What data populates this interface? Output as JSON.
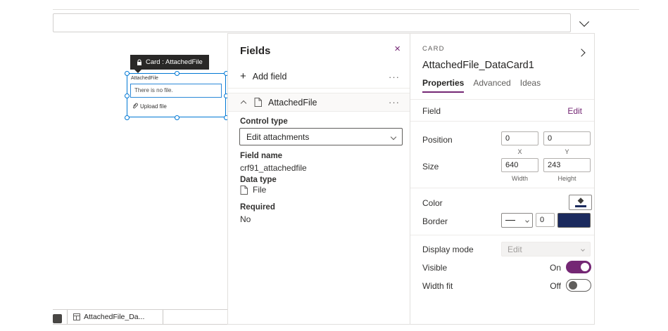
{
  "icons": {
    "ellipsis": "···",
    "close": "×",
    "plus": "+"
  },
  "canvas": {
    "tooltip_label": "Card : AttachedFile",
    "card_label": "AttachedFile",
    "no_file_text": "There is no file.",
    "upload_text": "Upload file"
  },
  "fields_panel": {
    "title": "Fields",
    "add_field_label": "Add field",
    "item_name": "AttachedFile",
    "control_type_label": "Control type",
    "control_type_value": "Edit attachments",
    "field_name_label": "Field name",
    "field_name_value": "crf91_attachedfile",
    "data_type_label": "Data type",
    "data_type_value": "File",
    "required_label": "Required",
    "required_value": "No"
  },
  "properties_panel": {
    "breadcrumb": "CARD",
    "title": "AttachedFile_DataCard1",
    "tabs": [
      "Properties",
      "Advanced",
      "Ideas"
    ],
    "field_label": "Field",
    "field_action": "Edit",
    "position_label": "Position",
    "position_x": "0",
    "position_y": "0",
    "x_caption": "X",
    "y_caption": "Y",
    "size_label": "Size",
    "size_width": "640",
    "size_height": "243",
    "width_caption": "Width",
    "height_caption": "Height",
    "color_label": "Color",
    "border_label": "Border",
    "border_thickness": "0",
    "display_mode_label": "Display mode",
    "display_mode_value": "Edit",
    "visible_label": "Visible",
    "visible_state": "On",
    "width_fit_label": "Width fit",
    "width_fit_state": "Off"
  },
  "bottom_bar": {
    "tab_label": "AttachedFile_Da..."
  },
  "colors": {
    "accent": "#742774",
    "selection_blue": "#0078d4",
    "border_swatch": "#1b2a5e",
    "tooltip_bg": "#292827"
  }
}
